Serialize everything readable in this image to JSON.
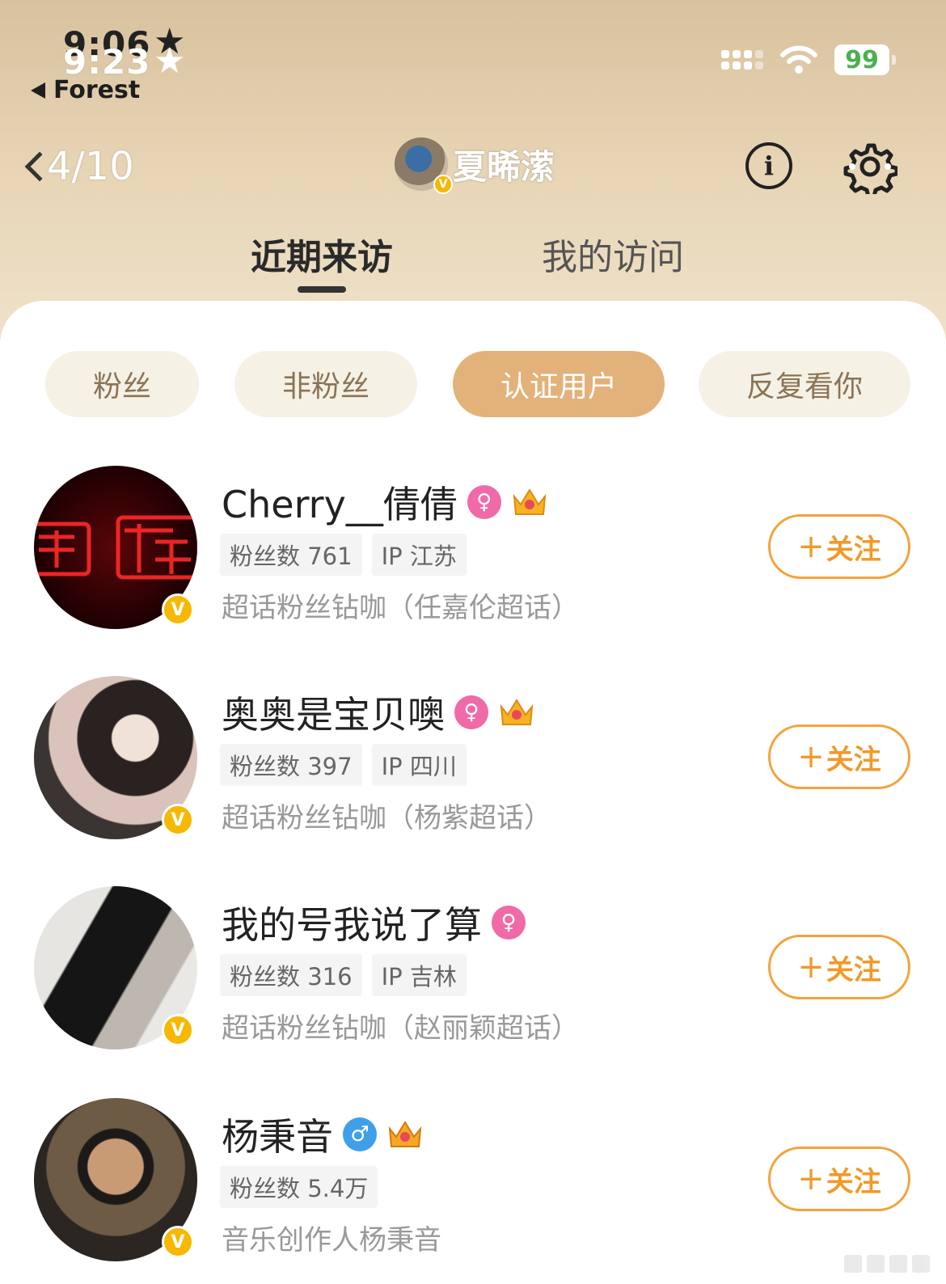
{
  "status_bar": {
    "time_back": "9:06",
    "time_front": "9:23",
    "star": "★",
    "back_app": "Forest",
    "battery": "99"
  },
  "nav": {
    "counter": "4/10",
    "profile_name": "夏晞潆"
  },
  "tabs": [
    {
      "label": "近期来访",
      "active": true
    },
    {
      "label": "我的访问",
      "active": false
    }
  ],
  "filters": [
    {
      "label": "粉丝",
      "active": false
    },
    {
      "label": "非粉丝",
      "active": false
    },
    {
      "label": "认证用户",
      "active": true
    },
    {
      "label": "反复看你",
      "active": false
    }
  ],
  "users": [
    {
      "name": "Cherry__倩倩",
      "gender": "female",
      "gender_symbol": "♀",
      "crown": true,
      "fans": "粉丝数 761",
      "ip": "IP 江苏",
      "desc": "超话粉丝钻咖（任嘉伦超话）",
      "verified": "V",
      "follow_label": "关注",
      "follow_plus": "+"
    },
    {
      "name": "奥奥是宝贝噢",
      "gender": "female",
      "gender_symbol": "♀",
      "crown": true,
      "fans": "粉丝数 397",
      "ip": "IP 四川",
      "desc": "超话粉丝钻咖（杨紫超话）",
      "verified": "V",
      "follow_label": "关注",
      "follow_plus": "+"
    },
    {
      "name": "我的号我说了算",
      "gender": "female",
      "gender_symbol": "♀",
      "crown": false,
      "fans": "粉丝数 316",
      "ip": "IP 吉林",
      "desc": "超话粉丝钻咖（赵丽颖超话）",
      "verified": "V",
      "follow_label": "关注",
      "follow_plus": "+"
    },
    {
      "name": "杨秉音",
      "gender": "male",
      "gender_symbol": "♂",
      "crown": true,
      "fans": "粉丝数 5.4万",
      "ip": "",
      "desc": "音乐创作人杨秉音",
      "verified": "V",
      "follow_label": "关注",
      "follow_plus": "+"
    }
  ],
  "colors": {
    "accent_orange": "#f09a2a",
    "chip_active": "#e2b27a",
    "verified_gold": "#f6b800",
    "female_pink": "#f06aa8",
    "male_blue": "#3fa0ea"
  }
}
